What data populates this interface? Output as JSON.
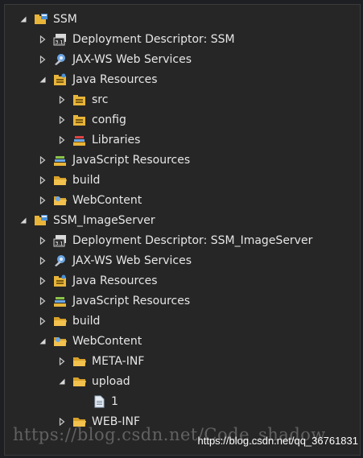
{
  "tree": {
    "rows": [
      {
        "label": "SSM",
        "depth": 0,
        "expanded": true,
        "icon": "project-icon"
      },
      {
        "label": "Deployment Descriptor: SSM",
        "depth": 1,
        "expanded": false,
        "icon": "deployment-descriptor-icon"
      },
      {
        "label": "JAX-WS Web Services",
        "depth": 1,
        "expanded": false,
        "icon": "web-services-icon"
      },
      {
        "label": "Java Resources",
        "depth": 1,
        "expanded": true,
        "icon": "java-resources-icon"
      },
      {
        "label": "src",
        "depth": 2,
        "expanded": false,
        "icon": "source-folder-icon"
      },
      {
        "label": "config",
        "depth": 2,
        "expanded": false,
        "icon": "source-folder-icon"
      },
      {
        "label": "Libraries",
        "depth": 2,
        "expanded": false,
        "icon": "libraries-icon"
      },
      {
        "label": "JavaScript Resources",
        "depth": 1,
        "expanded": false,
        "icon": "javascript-resources-icon"
      },
      {
        "label": "build",
        "depth": 1,
        "expanded": false,
        "icon": "folder-icon"
      },
      {
        "label": "WebContent",
        "depth": 1,
        "expanded": false,
        "icon": "webcontent-folder-icon"
      },
      {
        "label": "SSM_ImageServer",
        "depth": 0,
        "expanded": true,
        "icon": "project-icon"
      },
      {
        "label": "Deployment Descriptor: SSM_ImageServer",
        "depth": 1,
        "expanded": false,
        "icon": "deployment-descriptor-icon"
      },
      {
        "label": "JAX-WS Web Services",
        "depth": 1,
        "expanded": false,
        "icon": "web-services-icon"
      },
      {
        "label": "Java Resources",
        "depth": 1,
        "expanded": false,
        "icon": "java-resources-icon"
      },
      {
        "label": "JavaScript Resources",
        "depth": 1,
        "expanded": false,
        "icon": "javascript-resources-icon"
      },
      {
        "label": "build",
        "depth": 1,
        "expanded": false,
        "icon": "folder-icon"
      },
      {
        "label": "WebContent",
        "depth": 1,
        "expanded": true,
        "icon": "webcontent-folder-icon"
      },
      {
        "label": "META-INF",
        "depth": 2,
        "expanded": false,
        "icon": "folder-icon"
      },
      {
        "label": "upload",
        "depth": 2,
        "expanded": true,
        "icon": "folder-icon"
      },
      {
        "label": "1",
        "depth": 3,
        "leaf": true,
        "icon": "file-icon"
      },
      {
        "label": "WEB-INF",
        "depth": 2,
        "expanded": false,
        "icon": "folder-icon"
      }
    ]
  },
  "watermark": {
    "text": "https://blog.csdn.net/Code_shadow",
    "url": "https://blog.csdn.net/qq_36761831"
  },
  "colors": {
    "background": "#262626",
    "text": "#e6e6e6",
    "folder": "#e8b53a",
    "arrow": "#c8c8c8"
  }
}
